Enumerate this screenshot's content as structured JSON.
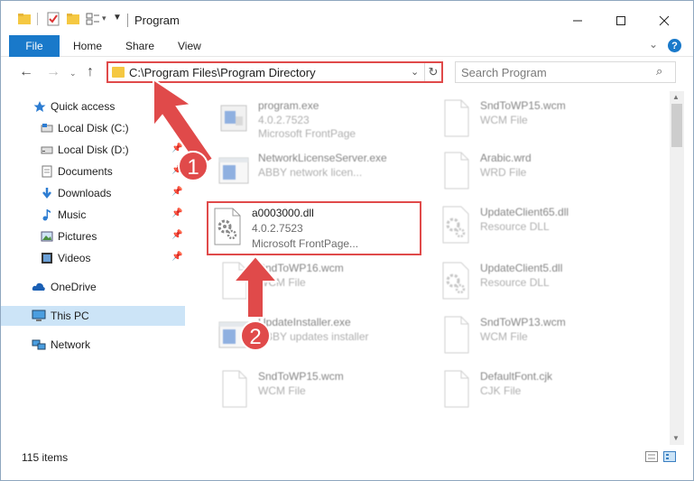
{
  "window": {
    "title": "Program",
    "accent": "#1979ca",
    "highlight_color": "#e04a4a"
  },
  "ribbon": {
    "file_label": "File",
    "tabs": [
      "Home",
      "Share",
      "View"
    ],
    "help_label": "?"
  },
  "navbar": {
    "path": "C:\\Program Files\\Program Directory",
    "search_placeholder": "Search Program"
  },
  "sidebar": {
    "items": [
      {
        "label": "Quick access",
        "icon": "star-icon"
      },
      {
        "label": "Local Disk (C:)",
        "icon": "drive-icon"
      },
      {
        "label": "Local Disk (D:)",
        "icon": "drive-icon"
      },
      {
        "label": "Documents",
        "icon": "documents-icon"
      },
      {
        "label": "Downloads",
        "icon": "download-icon"
      },
      {
        "label": "Music",
        "icon": "music-icon"
      },
      {
        "label": "Pictures",
        "icon": "pictures-icon"
      },
      {
        "label": "Videos",
        "icon": "videos-icon"
      },
      {
        "label": "OneDrive",
        "icon": "cloud-icon"
      },
      {
        "label": "This PC",
        "icon": "computer-icon"
      },
      {
        "label": "Network",
        "icon": "network-icon"
      }
    ]
  },
  "files": [
    {
      "name": "program.exe",
      "meta1": "4.0.2.7523",
      "meta2": "Microsoft FrontPage",
      "icon": "exe-icon"
    },
    {
      "name": "SndToWP15.wcm",
      "meta1": "WCM File",
      "meta2": "",
      "icon": "document-icon"
    },
    {
      "name": "NetworkLicenseServer.exe",
      "meta1": "ABBY network licen...",
      "meta2": "",
      "icon": "app-window-icon"
    },
    {
      "name": "Arabic.wrd",
      "meta1": "WRD File",
      "meta2": "",
      "icon": "document-icon"
    },
    {
      "name": "a0003000.dll",
      "meta1": "4.0.2.7523",
      "meta2": "Microsoft FrontPage...",
      "icon": "dll-gear-icon"
    },
    {
      "name": "UpdateClient65.dll",
      "meta1": "Resource DLL",
      "meta2": "",
      "icon": "dll-gear-icon"
    },
    {
      "name": "SndToWP16.wcm",
      "meta1": "WCM File",
      "meta2": "",
      "icon": "document-icon"
    },
    {
      "name": "UpdateClient5.dll",
      "meta1": "Resource DLL",
      "meta2": "",
      "icon": "dll-gear-icon"
    },
    {
      "name": "UpdateInstaller.exe",
      "meta1": "ABBY updates installer",
      "meta2": "",
      "icon": "app-window-icon"
    },
    {
      "name": "SndToWP13.wcm",
      "meta1": "WCM File",
      "meta2": "",
      "icon": "document-icon"
    },
    {
      "name": "SndToWP15.wcm",
      "meta1": "WCM File",
      "meta2": "",
      "icon": "document-icon"
    },
    {
      "name": "DefaultFont.cjk",
      "meta1": "CJK File",
      "meta2": "",
      "icon": "document-icon"
    }
  ],
  "annotations": {
    "step1": "1",
    "step2": "2"
  },
  "status": {
    "count": "115 items"
  }
}
